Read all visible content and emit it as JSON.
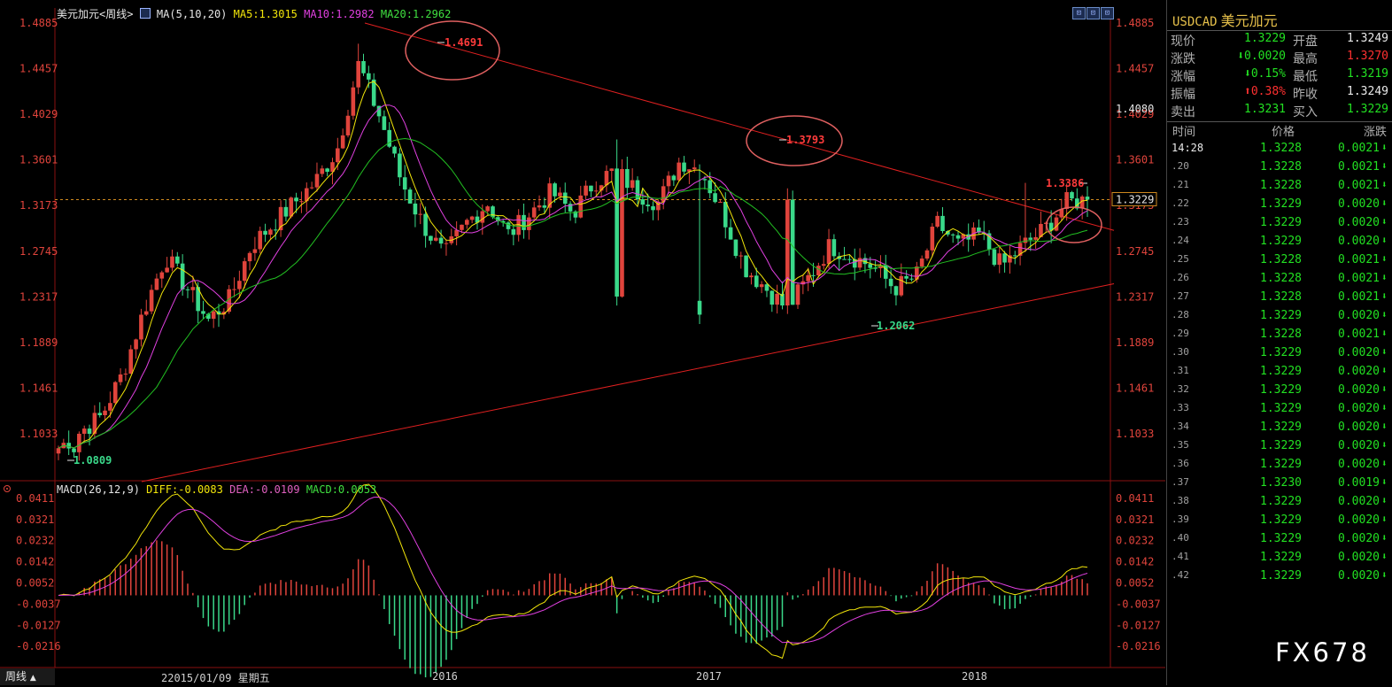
{
  "chart": {
    "legend_main": {
      "title": "美元加元<周线>",
      "ma_params": "MA(5,10,20)",
      "ma5": "MA5:1.3015",
      "ma10": "MA10:1.2982",
      "ma20": "MA20:1.2962"
    },
    "legend_macd": {
      "params": "MACD(26,12,9)",
      "diff": "DIFF:-0.0083",
      "dea": "DEA:-0.0109",
      "macd": "MACD:0.0053"
    },
    "price_axis_ticks": [
      "1.4885",
      "1.4457",
      "1.4029",
      "1.3601",
      "1.3173",
      "1.2745",
      "1.2317",
      "1.1889",
      "1.1461",
      "1.1033"
    ],
    "macd_axis_ticks": [
      "0.0411",
      "0.0321",
      "0.0232",
      "0.0142",
      "0.0052",
      "-0.0037",
      "-0.0127",
      "-0.0216"
    ],
    "right_axis_marks": {
      "level": "1.4080",
      "current": "1.3229"
    },
    "annotations": {
      "high_2016": "1.4691",
      "high_2017": "1.3793",
      "recent_high": "1.3386",
      "low_2017": "1.2062",
      "low_2015": "1.0809"
    },
    "time_labels": {
      "start": "22015/01/09 星期五",
      "y2016": "2016",
      "y2017": "2017",
      "y2018": "2018"
    },
    "period_button": "周线",
    "toolbar_buttons": [
      "⊡",
      "⊡",
      "⊡"
    ],
    "watermark": "FX678",
    "colors": {
      "up": "#e0443c",
      "down": "#3ad98a",
      "ma5": "#f2e60a",
      "ma10": "#e040e0",
      "ma20": "#22c022",
      "trend": "#e02020"
    }
  },
  "chart_data": {
    "type": "candlestick",
    "title": "美元加元<周线>",
    "ylim": [
      1.0809,
      1.4885
    ],
    "key_points": [
      {
        "label": "low",
        "value": 1.0809
      },
      {
        "label": "high",
        "value": 1.4691
      },
      {
        "label": "high",
        "value": 1.3793
      },
      {
        "label": "low",
        "value": 1.2062
      },
      {
        "label": "high",
        "value": 1.3386
      }
    ],
    "close_anchors": [
      1.09,
      1.105,
      1.12,
      1.16,
      1.22,
      1.27,
      1.24,
      1.21,
      1.23,
      1.28,
      1.3,
      1.32,
      1.34,
      1.37,
      1.45,
      1.4,
      1.34,
      1.3,
      1.27,
      1.3,
      1.32,
      1.29,
      1.31,
      1.33,
      1.31,
      1.34,
      1.35,
      1.33,
      1.32,
      1.36,
      1.35,
      1.31,
      1.26,
      1.24,
      1.22,
      1.25,
      1.28,
      1.27,
      1.26,
      1.24,
      1.25,
      1.3,
      1.28,
      1.29,
      1.26,
      1.28,
      1.295,
      1.32,
      1.3229
    ],
    "current_price": 1.3229
  },
  "panel": {
    "symbol_code": "USDCAD",
    "symbol_name": "美元加元",
    "rows": [
      {
        "l1": "现价",
        "v1": "1.3229",
        "c1": "green",
        "l2": "开盘",
        "v2": "1.3249",
        "c2": "white"
      },
      {
        "l1": "涨跌",
        "v1": "⬇0.0020",
        "c1": "green",
        "l2": "最高",
        "v2": "1.3270",
        "c2": "red"
      },
      {
        "l1": "涨幅",
        "v1": "⬇0.15%",
        "c1": "green",
        "l2": "最低",
        "v2": "1.3219",
        "c2": "green"
      },
      {
        "l1": "振幅",
        "v1": "⬆0.38%",
        "c1": "red",
        "l2": "昨收",
        "v2": "1.3249",
        "c2": "white"
      },
      {
        "l1": "卖出",
        "v1": "1.3231",
        "c1": "green",
        "l2": "买入",
        "v2": "1.3229",
        "c2": "green"
      }
    ],
    "ticks_header": {
      "time": "时间",
      "price": "价格",
      "change": "涨跌"
    },
    "ticks": [
      {
        "time": "14:28",
        "price": "1.3228",
        "change": "0.0021"
      },
      {
        "time": ".20",
        "price": "1.3228",
        "change": "0.0021"
      },
      {
        "time": ".21",
        "price": "1.3228",
        "change": "0.0021"
      },
      {
        "time": ".22",
        "price": "1.3229",
        "change": "0.0020"
      },
      {
        "time": ".23",
        "price": "1.3229",
        "change": "0.0020"
      },
      {
        "time": ".24",
        "price": "1.3229",
        "change": "0.0020"
      },
      {
        "time": ".25",
        "price": "1.3228",
        "change": "0.0021"
      },
      {
        "time": ".26",
        "price": "1.3228",
        "change": "0.0021"
      },
      {
        "time": ".27",
        "price": "1.3228",
        "change": "0.0021"
      },
      {
        "time": ".28",
        "price": "1.3229",
        "change": "0.0020"
      },
      {
        "time": ".29",
        "price": "1.3228",
        "change": "0.0021"
      },
      {
        "time": ".30",
        "price": "1.3229",
        "change": "0.0020"
      },
      {
        "time": ".31",
        "price": "1.3229",
        "change": "0.0020"
      },
      {
        "time": ".32",
        "price": "1.3229",
        "change": "0.0020"
      },
      {
        "time": ".33",
        "price": "1.3229",
        "change": "0.0020"
      },
      {
        "time": ".34",
        "price": "1.3229",
        "change": "0.0020"
      },
      {
        "time": ".35",
        "price": "1.3229",
        "change": "0.0020"
      },
      {
        "time": ".36",
        "price": "1.3229",
        "change": "0.0020"
      },
      {
        "time": ".37",
        "price": "1.3230",
        "change": "0.0019"
      },
      {
        "time": ".38",
        "price": "1.3229",
        "change": "0.0020"
      },
      {
        "time": ".39",
        "price": "1.3229",
        "change": "0.0020"
      },
      {
        "time": ".40",
        "price": "1.3229",
        "change": "0.0020"
      },
      {
        "time": ".41",
        "price": "1.3229",
        "change": "0.0020"
      },
      {
        "time": ".42",
        "price": "1.3229",
        "change": "0.0020"
      }
    ]
  }
}
